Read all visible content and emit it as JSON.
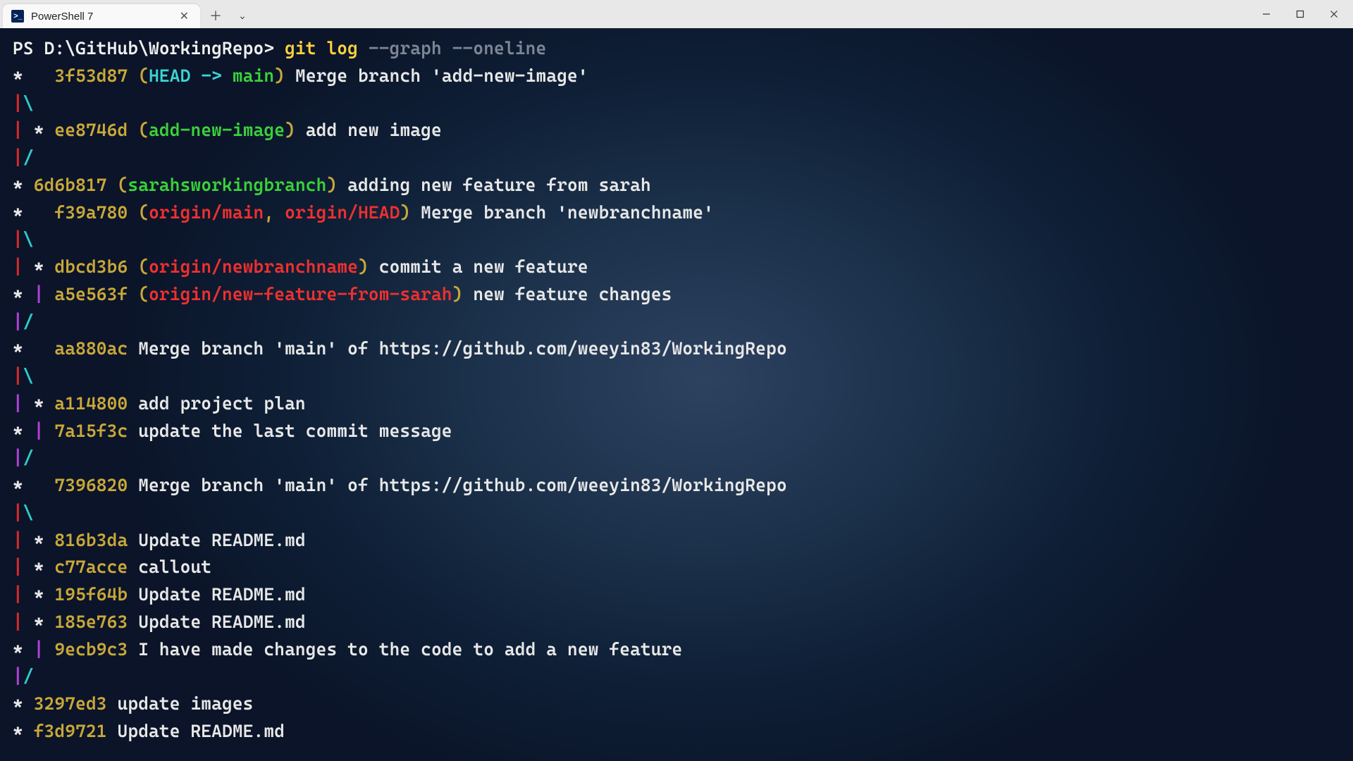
{
  "titlebar": {
    "tab_title": "PowerShell 7",
    "tab_icon_text": ">_"
  },
  "prompt": {
    "ps_path": "PS D:\\GitHub\\WorkingRepo> ",
    "command": "git log",
    "flag1": " --graph",
    "flag2": " --oneline"
  },
  "lines": [
    {
      "graph": [
        {
          "t": "*   ",
          "c": "white"
        }
      ],
      "hash": "3f53d87",
      "refs": [
        {
          "t": "(",
          "c": "paren"
        },
        {
          "t": "HEAD -> ",
          "c": "cyan"
        },
        {
          "t": "main",
          "c": "green"
        },
        {
          "t": ")",
          "c": "paren"
        }
      ],
      "msg": " Merge branch 'add-new-image'"
    },
    {
      "graph": [
        {
          "t": "|",
          "c": "red"
        },
        {
          "t": "\\",
          "c": "cyan"
        }
      ]
    },
    {
      "graph": [
        {
          "t": "| ",
          "c": "red"
        },
        {
          "t": "* ",
          "c": "white"
        }
      ],
      "hash": "ee8746d",
      "refs": [
        {
          "t": "(",
          "c": "paren"
        },
        {
          "t": "add-new-image",
          "c": "green"
        },
        {
          "t": ")",
          "c": "paren"
        }
      ],
      "msg": " add new image"
    },
    {
      "graph": [
        {
          "t": "|",
          "c": "red"
        },
        {
          "t": "/",
          "c": "cyan"
        }
      ]
    },
    {
      "graph": [
        {
          "t": "* ",
          "c": "white"
        }
      ],
      "hash": "6d6b817",
      "refs": [
        {
          "t": "(",
          "c": "paren"
        },
        {
          "t": "sarahsworkingbranch",
          "c": "green"
        },
        {
          "t": ")",
          "c": "paren"
        }
      ],
      "msg": " adding new feature from sarah"
    },
    {
      "graph": [
        {
          "t": "*   ",
          "c": "white"
        }
      ],
      "hash": "f39a780",
      "refs": [
        {
          "t": "(",
          "c": "paren"
        },
        {
          "t": "origin/main",
          "c": "red"
        },
        {
          "t": ", ",
          "c": "paren"
        },
        {
          "t": "origin/HEAD",
          "c": "red"
        },
        {
          "t": ")",
          "c": "paren"
        }
      ],
      "msg": " Merge branch 'newbranchname'"
    },
    {
      "graph": [
        {
          "t": "|",
          "c": "red"
        },
        {
          "t": "\\",
          "c": "cyan"
        }
      ]
    },
    {
      "graph": [
        {
          "t": "| ",
          "c": "red"
        },
        {
          "t": "* ",
          "c": "white"
        }
      ],
      "hash": "dbcd3b6",
      "refs": [
        {
          "t": "(",
          "c": "paren"
        },
        {
          "t": "origin/newbranchname",
          "c": "red"
        },
        {
          "t": ")",
          "c": "paren"
        }
      ],
      "msg": " commit a new feature"
    },
    {
      "graph": [
        {
          "t": "* ",
          "c": "white"
        },
        {
          "t": "| ",
          "c": "mag"
        }
      ],
      "hash": "a5e563f",
      "refs": [
        {
          "t": "(",
          "c": "paren"
        },
        {
          "t": "origin/new-feature-from-sarah",
          "c": "red"
        },
        {
          "t": ")",
          "c": "paren"
        }
      ],
      "msg": " new feature changes"
    },
    {
      "graph": [
        {
          "t": "|",
          "c": "mag"
        },
        {
          "t": "/",
          "c": "cyan"
        }
      ]
    },
    {
      "graph": [
        {
          "t": "*   ",
          "c": "white"
        }
      ],
      "hash": "aa880ac",
      "msg": " Merge branch 'main' of https://github.com/weeyin83/WorkingRepo"
    },
    {
      "graph": [
        {
          "t": "|",
          "c": "red"
        },
        {
          "t": "\\",
          "c": "cyan"
        }
      ]
    },
    {
      "graph": [
        {
          "t": "| ",
          "c": "mag"
        },
        {
          "t": "* ",
          "c": "white"
        }
      ],
      "hash": "a114800",
      "msg": " add project plan"
    },
    {
      "graph": [
        {
          "t": "* ",
          "c": "white"
        },
        {
          "t": "| ",
          "c": "mag"
        }
      ],
      "hash": "7a15f3c",
      "msg": " update the last commit message"
    },
    {
      "graph": [
        {
          "t": "|",
          "c": "mag"
        },
        {
          "t": "/",
          "c": "cyan"
        }
      ]
    },
    {
      "graph": [
        {
          "t": "*   ",
          "c": "white"
        }
      ],
      "hash": "7396820",
      "msg": " Merge branch 'main' of https://github.com/weeyin83/WorkingRepo"
    },
    {
      "graph": [
        {
          "t": "|",
          "c": "red"
        },
        {
          "t": "\\",
          "c": "cyan"
        }
      ]
    },
    {
      "graph": [
        {
          "t": "| ",
          "c": "red"
        },
        {
          "t": "* ",
          "c": "white"
        }
      ],
      "hash": "816b3da",
      "msg": " Update README.md"
    },
    {
      "graph": [
        {
          "t": "| ",
          "c": "red"
        },
        {
          "t": "* ",
          "c": "white"
        }
      ],
      "hash": "c77acce",
      "msg": " callout"
    },
    {
      "graph": [
        {
          "t": "| ",
          "c": "red"
        },
        {
          "t": "* ",
          "c": "white"
        }
      ],
      "hash": "195f64b",
      "msg": " Update README.md"
    },
    {
      "graph": [
        {
          "t": "| ",
          "c": "red"
        },
        {
          "t": "* ",
          "c": "white"
        }
      ],
      "hash": "185e763",
      "msg": " Update README.md"
    },
    {
      "graph": [
        {
          "t": "* ",
          "c": "white"
        },
        {
          "t": "| ",
          "c": "mag"
        }
      ],
      "hash": "9ecb9c3",
      "msg": " I have made changes to the code to add a new feature"
    },
    {
      "graph": [
        {
          "t": "|",
          "c": "mag"
        },
        {
          "t": "/",
          "c": "cyan"
        }
      ]
    },
    {
      "graph": [
        {
          "t": "* ",
          "c": "white"
        }
      ],
      "hash": "3297ed3",
      "msg": " update images"
    },
    {
      "graph": [
        {
          "t": "* ",
          "c": "white"
        }
      ],
      "hash": "f3d9721",
      "msg": " Update README.md"
    }
  ]
}
